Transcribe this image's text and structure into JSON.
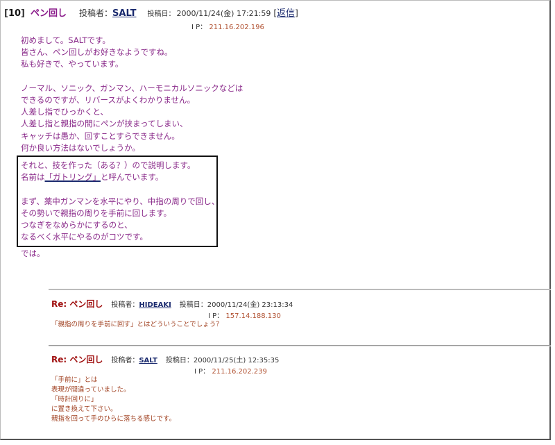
{
  "post": {
    "number": "10",
    "title": "ペン回し",
    "author_label": "投稿者：",
    "author": "SALT",
    "date_label": "投稿日：",
    "date": "2000/11/24(金) 17:21:59",
    "reply_link": "返信",
    "ip_label": "I P：",
    "ip": "211.16.202.196",
    "body_lines": [
      "初めまして。SALTです。",
      "皆さん、ペン回しがお好きなようですね。",
      "私も好きで、やっています。",
      "",
      "ノーマル、ソニック、ガンマン、ハーモニカルソニックなどは",
      "できるのですが、リバースがよくわかりません。",
      "人差し指でひっかくと、",
      "人差し指と親指の間にペンが挟まってしまい、",
      "キャッチは愚か、回すことすらできません。",
      "何か良い方法はないでしょうか。"
    ],
    "boxed": {
      "line1": "それと、技を作った（ある？）ので説明します。",
      "line2_prefix": "名前は",
      "line2_highlight": "「ガトリング」",
      "line2_suffix": "と呼んでいます。",
      "lines_after": [
        "まず、薬中ガンマンを水平にやり、中指の周りで回し、",
        "その勢いで親指の周りを手前に回します。",
        "つなぎをなめらかにするのと、",
        "なるべく水平にやるのがコツです。"
      ]
    },
    "closing": "では。"
  },
  "replies": [
    {
      "title": "Re:  ペン回し",
      "author_label": "投稿者：",
      "author": "HIDEAKI",
      "date_label": "投稿日：",
      "date": "2000/11/24(金) 23:13:34",
      "ip_label": "I P：",
      "ip": "157.14.188.130",
      "body_lines": [
        "「親指の周りを手前に回す」とはどういうことでしょう？"
      ]
    },
    {
      "title": "Re:  ペン回し",
      "author_label": "投稿者：",
      "author": "SALT",
      "date_label": "投稿日：",
      "date": "2000/11/25(土) 12:35:35",
      "ip_label": "I P：",
      "ip": "211.16.202.239",
      "body_lines": [
        "「手前に」とは",
        "表現が間違っていました。",
        "「時計回りに」",
        "に置き換えて下さい。",
        "親指を回って手のひらに落ちる感じです。"
      ]
    }
  ]
}
